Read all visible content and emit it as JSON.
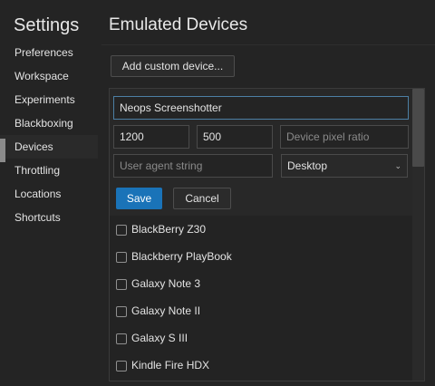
{
  "sidebar": {
    "title": "Settings",
    "items": [
      {
        "label": "Preferences"
      },
      {
        "label": "Workspace"
      },
      {
        "label": "Experiments"
      },
      {
        "label": "Blackboxing"
      },
      {
        "label": "Devices"
      },
      {
        "label": "Throttling"
      },
      {
        "label": "Locations"
      },
      {
        "label": "Shortcuts"
      }
    ]
  },
  "main": {
    "title": "Emulated Devices",
    "add_button_label": "Add custom device...",
    "editor": {
      "name_value": "Neops Screenshotter",
      "width_value": "1200",
      "height_value": "500",
      "dpr_placeholder": "Device pixel ratio",
      "ua_placeholder": "User agent string",
      "ua_type_value": "Desktop",
      "save_label": "Save",
      "cancel_label": "Cancel"
    },
    "devices": [
      {
        "label": "BlackBerry Z30",
        "checked": false
      },
      {
        "label": "Blackberry PlayBook",
        "checked": false
      },
      {
        "label": "Galaxy Note 3",
        "checked": false
      },
      {
        "label": "Galaxy Note II",
        "checked": false
      },
      {
        "label": "Galaxy S III",
        "checked": false
      },
      {
        "label": "Kindle Fire HDX",
        "checked": false
      }
    ]
  },
  "colors": {
    "background": "#242424",
    "accent": "#1a73b8",
    "focus_border": "#4c7fa4"
  }
}
